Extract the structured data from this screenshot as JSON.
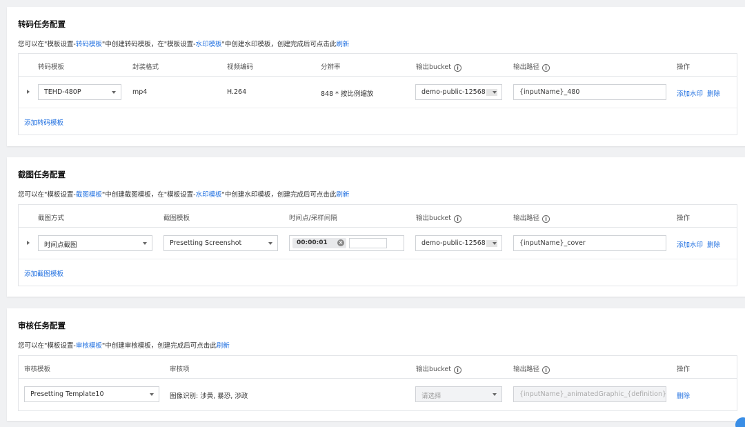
{
  "transcode": {
    "title": "转码任务配置",
    "desc": {
      "p1": "您可以在\"模板设置-",
      "l1": "转码模板",
      "p2": "\"中创建转码模板，在\"模板设置-",
      "l2": "水印模板",
      "p3": "\"中创建水印模板，创建完成后可点击此",
      "l3": "刷新"
    },
    "headers": {
      "template": "转码模板",
      "format": "封装格式",
      "codec": "视频编码",
      "resolution": "分辨率",
      "bucket": "输出bucket",
      "path": "输出路径",
      "ops": "操作"
    },
    "row": {
      "template": "TEHD-480P",
      "format": "mp4",
      "codec": "H.264",
      "resolution": "848 * 按比例缩放",
      "bucket": "demo-public-12568",
      "path": "{inputName}_480",
      "add_watermark": "添加水印",
      "delete": "删除"
    },
    "add_label": "添加转码模板"
  },
  "snapshot": {
    "title": "截图任务配置",
    "desc": {
      "p1": "您可以在\"模板设置-",
      "l1": "截图模板",
      "p2": "\"中创建截图模板，在\"模板设置-",
      "l2": "水印模板",
      "p3": "\"中创建水印模板，创建完成后可点击此",
      "l3": "刷新"
    },
    "headers": {
      "mode": "截图方式",
      "template": "截图模板",
      "time": "时间点/采样间隔",
      "bucket": "输出bucket",
      "path": "输出路径",
      "ops": "操作"
    },
    "row": {
      "mode": "时间点截图",
      "template": "Presetting Screenshot",
      "time_tag": "00:00:01",
      "bucket": "demo-public-12568",
      "path": "{inputName}_cover",
      "add_watermark": "添加水印",
      "delete": "删除"
    },
    "add_label": "添加截图模板"
  },
  "audit": {
    "title": "审核任务配置",
    "desc": {
      "p1": "您可以在\"模板设置-",
      "l1": "审核模板",
      "p2": "\"中创建审核模板，创建完成后可点击此",
      "l3": "刷新"
    },
    "headers": {
      "template": "审核模板",
      "items": "审核项",
      "bucket": "输出bucket",
      "path": "输出路径",
      "ops": "操作"
    },
    "row": {
      "template": "Presetting Template10",
      "items": "图像识别: 涉黄, 暴恐, 涉政",
      "bucket_placeholder": "请选择",
      "path": "{inputName}_animatedGraphic_{definition}.{form",
      "delete": "删除"
    }
  },
  "info_icon": "i",
  "icons": [
    "expand-caret-icon",
    "dropdown-arrow-icon",
    "info-icon",
    "clear-tag-icon"
  ],
  "colors": {
    "link": "#1f6fe0",
    "background": "#f0f1f3"
  }
}
